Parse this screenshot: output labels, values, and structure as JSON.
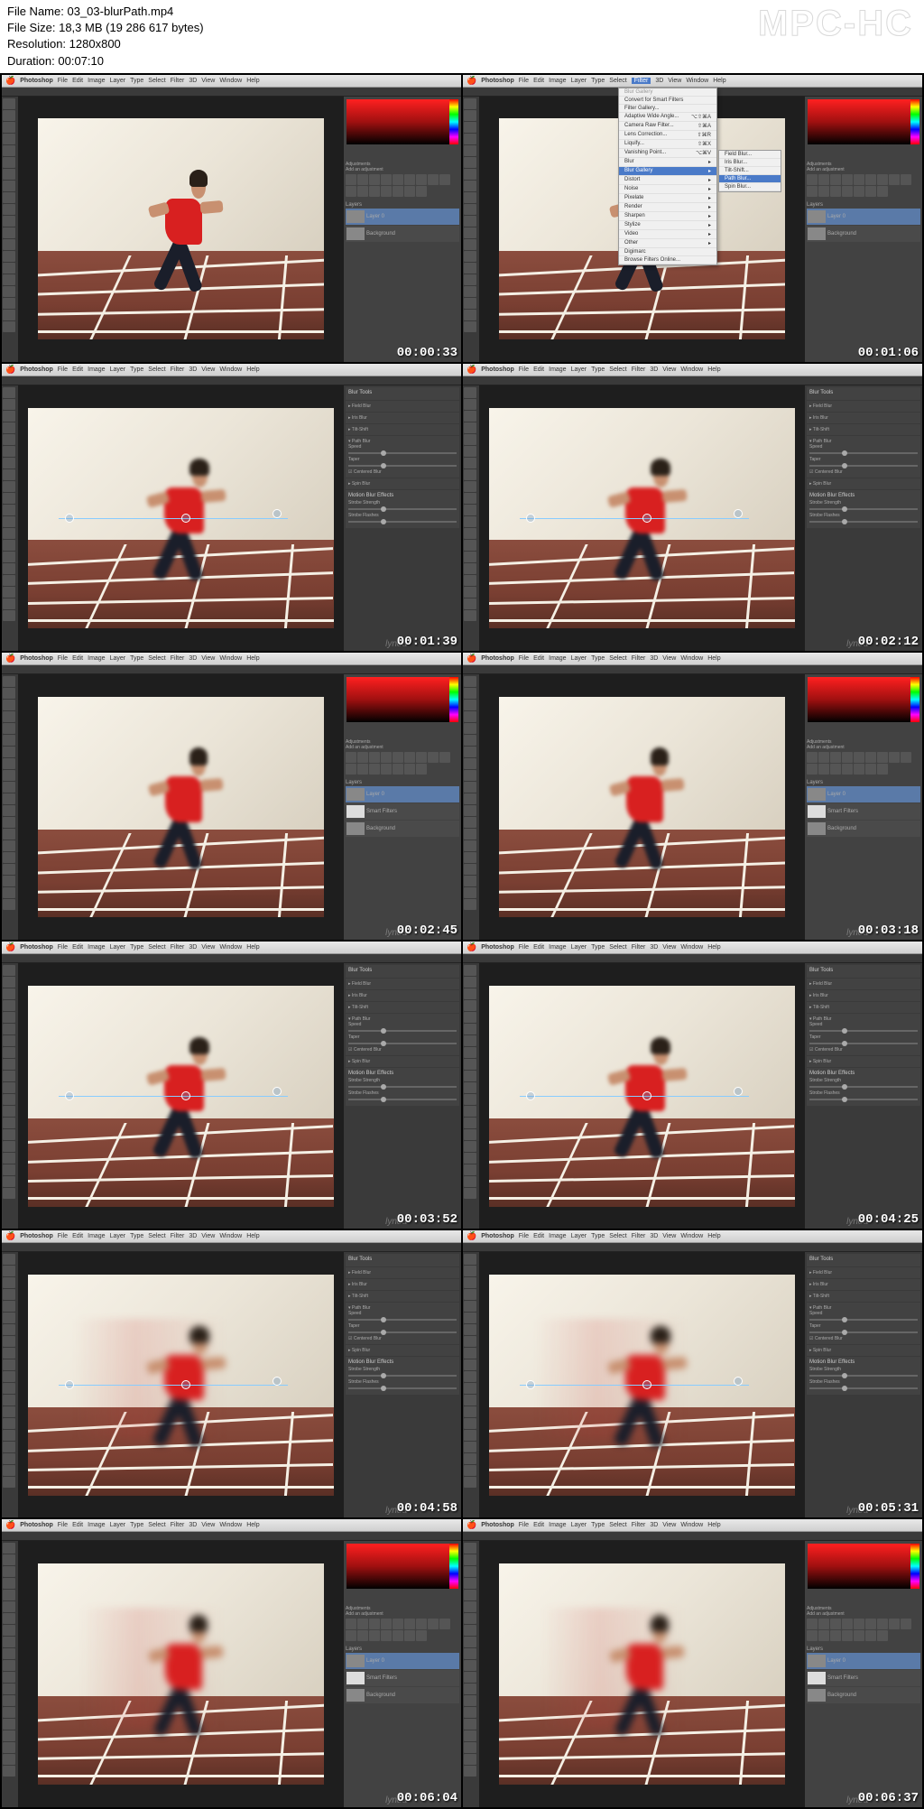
{
  "header": {
    "filename_label": "File Name:",
    "filename": "03_03-blurPath.mp4",
    "filesize_label": "File Size:",
    "filesize": "18,3 MB (19 286 617 bytes)",
    "resolution_label": "Resolution:",
    "resolution": "1280x800",
    "duration_label": "Duration:",
    "duration": "00:07:10",
    "watermark": "MPC-HC"
  },
  "menubar": {
    "app": "Photoshop",
    "items": [
      "File",
      "Edit",
      "Image",
      "Layer",
      "Type",
      "Select",
      "Filter",
      "3D",
      "View",
      "Window",
      "Help"
    ]
  },
  "filter_menu": {
    "top_item": "Blur Gallery",
    "convert": "Convert for Smart Filters",
    "items": [
      "Filter Gallery...",
      "Adaptive Wide Angle...",
      "Camera Raw Filter...",
      "Lens Correction...",
      "Liquify...",
      "Vanishing Point..."
    ],
    "shortcuts": [
      "",
      "⌥⇧⌘A",
      "⇧⌘A",
      "⇧⌘R",
      "⇧⌘X",
      "⌥⌘V"
    ],
    "categories": [
      "Blur",
      "Blur Gallery",
      "Distort",
      "Noise",
      "Pixelate",
      "Render",
      "Sharpen",
      "Stylize",
      "Video",
      "Other"
    ],
    "digimarc": "Digimarc",
    "browse": "Browse Filters Online...",
    "submenu_items": [
      "Field Blur...",
      "Iris Blur...",
      "Tilt-Shift...",
      "Path Blur...",
      "Spin Blur..."
    ]
  },
  "blur_tools": {
    "title": "Blur Tools",
    "field_blur": "Field Blur",
    "iris_blur": "Iris Blur",
    "tilt_shift": "Tilt-Shift",
    "path_blur": "Path Blur",
    "speed_label": "Speed",
    "taper_label": "Taper",
    "centered": "Centered Blur",
    "spin_blur": "Spin Blur",
    "motion_effects": "Motion Blur Effects",
    "strobe_strength": "Strobe Strength",
    "strobe_flashes": "Strobe Flashes"
  },
  "panels": {
    "adjustments": "Adjustments",
    "add_adjustment": "Add an adjustment",
    "layers": "Layers",
    "layer_bg": "Background",
    "layer_0": "Layer 0",
    "smart_filters": "Smart Filters",
    "blur_gallery": "Blur Gallery"
  },
  "timestamps": [
    "00:00:33",
    "00:01:06",
    "00:01:39",
    "00:02:12",
    "00:02:45",
    "00:03:18",
    "00:03:52",
    "00:04:25",
    "00:04:58",
    "00:05:31",
    "00:06:04",
    "00:06:37"
  ],
  "lynda": "lynda"
}
